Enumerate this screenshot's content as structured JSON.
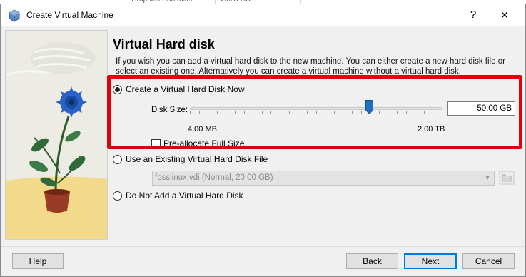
{
  "background": {
    "row_label": "Graphics Controller:",
    "row_value": "VMSVGA"
  },
  "window": {
    "title": "Create Virtual Machine",
    "help_glyph": "?",
    "close_glyph": "✕"
  },
  "page": {
    "heading": "Virtual Hard disk",
    "description": "If you wish you can add a virtual hard disk to the new machine. You can either create a new hard disk file or select an existing one. Alternatively you can create a virtual machine without a virtual hard disk."
  },
  "options": {
    "create_now": {
      "label": "Create a Virtual Hard Disk Now",
      "selected": true
    },
    "use_existing": {
      "label": "Use an Existing Virtual Hard Disk File",
      "selected": false
    },
    "no_disk": {
      "label": "Do Not Add a Virtual Hard Disk",
      "selected": false
    }
  },
  "disk_size": {
    "label": "Disk Size:",
    "value": "50.00 GB",
    "min_label": "4.00 MB",
    "max_label": "2.00 TB",
    "slider_position_fraction": 0.71
  },
  "preallocate": {
    "label": "Pre-allocate Full Size",
    "checked": false
  },
  "existing_file": {
    "selected": "fosslinux.vdi (Normal, 20.00 GB)",
    "enabled": false
  },
  "buttons": {
    "help": "Help",
    "back": "Back",
    "next": "Next",
    "cancel": "Cancel"
  },
  "colors": {
    "highlight_border": "#e0000b",
    "primary_button_border": "#0078d7",
    "slider_thumb": "#1e6fc3"
  }
}
